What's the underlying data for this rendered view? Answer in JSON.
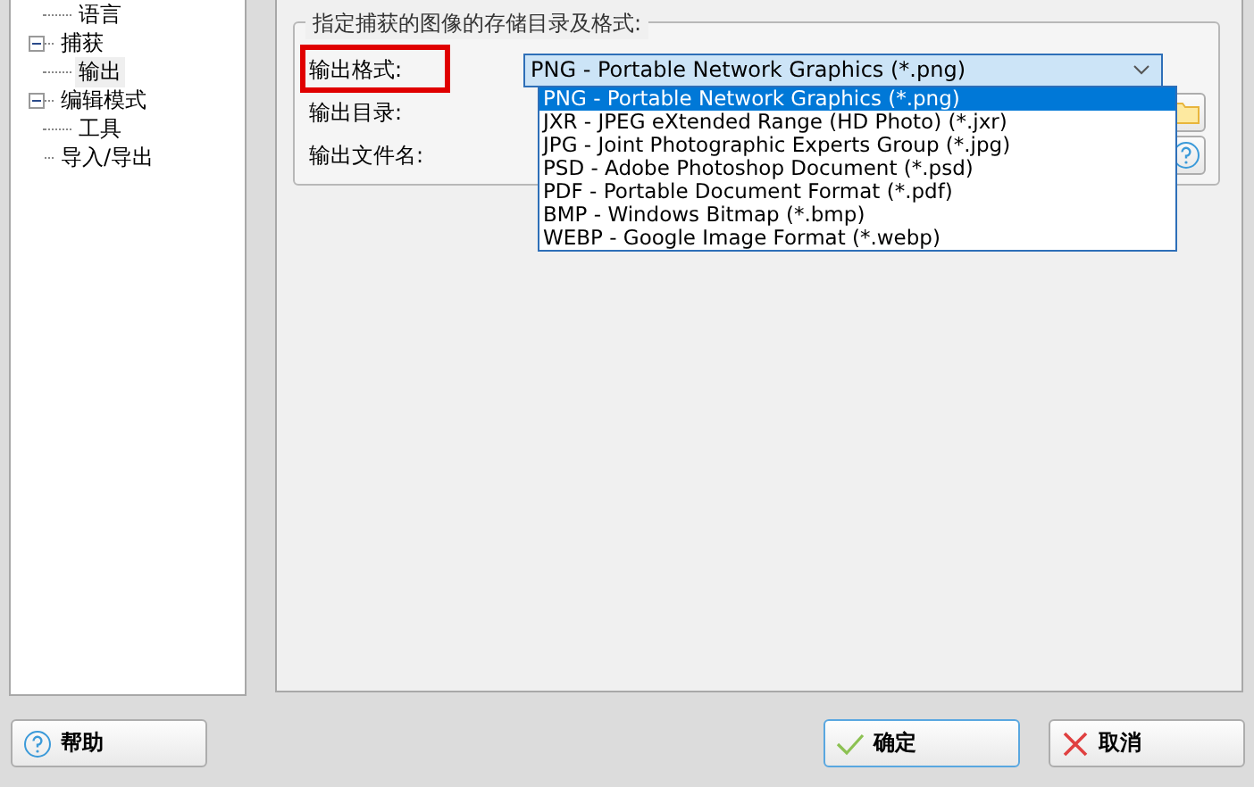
{
  "tree": {
    "scrolled_children": [
      {
        "label": "语言",
        "selected": false
      }
    ],
    "items": [
      {
        "label": "捕获",
        "expanded": true,
        "selected": false,
        "children": [
          {
            "label": "输出",
            "selected": true
          }
        ]
      },
      {
        "label": "编辑模式",
        "expanded": true,
        "selected": false,
        "children": [
          {
            "label": "工具",
            "selected": false
          }
        ]
      },
      {
        "label": "导入/导出",
        "selected": false
      }
    ]
  },
  "group": {
    "title": "指定捕获的图像的存储目录及格式:",
    "rows": [
      {
        "label": "输出格式:",
        "kind": "format"
      },
      {
        "label": "输出目录:",
        "kind": "folder"
      },
      {
        "label": "输出文件名:",
        "kind": "help"
      }
    ],
    "dropdown": {
      "value": "PNG - Portable Network Graphics (*.png)",
      "expanded": true,
      "options": [
        {
          "label": "PNG - Portable Network Graphics (*.png)",
          "selected": true
        },
        {
          "label": "JXR - JPEG eXtended Range (HD Photo) (*.jxr)",
          "selected": false
        },
        {
          "label": "JPG - Joint Photographic Experts Group (*.jpg)",
          "selected": false
        },
        {
          "label": "PSD - Adobe Photoshop Document (*.psd)",
          "selected": false
        },
        {
          "label": "PDF - Portable Document Format (*.pdf)",
          "selected": false
        },
        {
          "label": "BMP - Windows Bitmap (*.bmp)",
          "selected": false
        },
        {
          "label": "WEBP - Google Image Format (*.webp)",
          "selected": false
        }
      ]
    }
  },
  "buttons": [
    {
      "label": "帮助",
      "kind": "help"
    },
    {
      "label": "确定",
      "kind": "ok"
    },
    {
      "label": "取消",
      "kind": "cancel"
    }
  ]
}
